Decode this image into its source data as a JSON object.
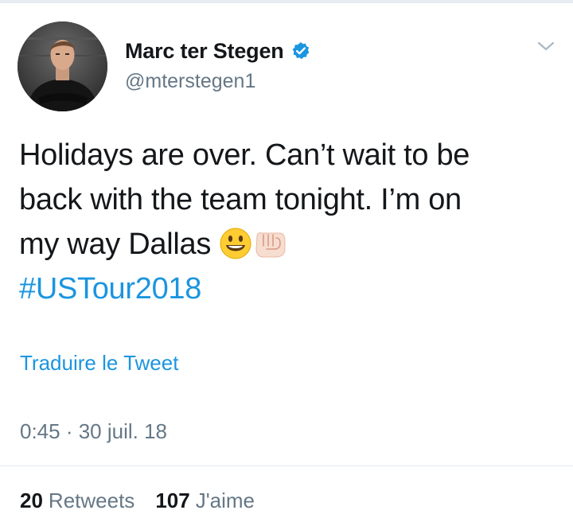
{
  "colors": {
    "accent": "#1b95e0",
    "text_primary": "#14171a",
    "text_secondary": "#657786",
    "divider": "#e6ecf0"
  },
  "author": {
    "display_name": "Marc ter Stegen",
    "handle": "@mterstegen1",
    "verified": true,
    "avatar_icon": "profile-photo",
    "verified_icon": "verified-badge-icon"
  },
  "header": {
    "menu_icon": "chevron-down-icon"
  },
  "tweet": {
    "line1": "Holidays are over. Can’t wait to be",
    "line2": "back with the team tonight. I’m on",
    "line3": "my way Dallas",
    "emojis": [
      "smiling-face-emoji",
      "fist-bump-emoji"
    ],
    "hashtag": "#USTour2018"
  },
  "translate_label": "Traduire le Tweet",
  "timestamp": "0:45 · 30 juil. 18",
  "stats": {
    "retweets_count": "20",
    "retweets_label": "Retweets",
    "likes_count": "107",
    "likes_label": "J'aime"
  }
}
